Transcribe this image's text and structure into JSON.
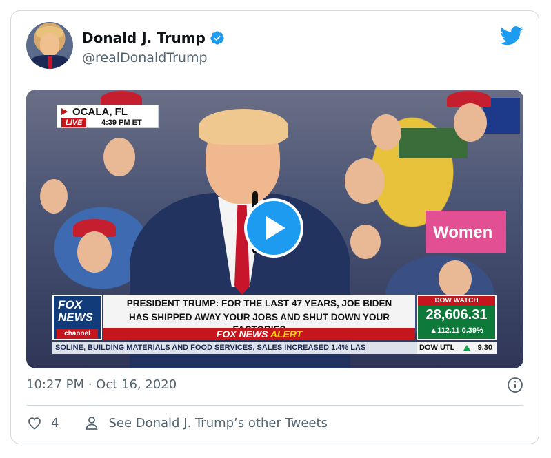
{
  "author": {
    "display_name": "Donald J. Trump",
    "handle": "@realDonaldTrump",
    "verified": true
  },
  "media": {
    "location": {
      "city": "OCALA, FL",
      "live": "LIVE",
      "time": "4:39 PM ET"
    },
    "sign_text": "Women",
    "fox_logo": [
      "FOX",
      "NEWS",
      "channel"
    ],
    "headline_line1": "PRESIDENT TRUMP: FOR THE LAST 47 YEARS, JOE BIDEN",
    "headline_line2": "HAS SHIPPED AWAY YOUR JOBS AND SHUT DOWN YOUR FACTORIES",
    "alert_prefix": "FOX NEWS",
    "alert_word": "ALERT",
    "dow": {
      "title": "DOW WATCH",
      "value": "28,606.31",
      "change": "▲112.11 0.39%"
    },
    "ticker": {
      "text": "SOLINE, BUILDING MATERIALS AND FOOD SERVICES, SALES INCREASED 1.4% LAS",
      "dow_label": "DOW UTL",
      "dow_value": "9.30"
    }
  },
  "timestamp": "10:27 PM · Oct 16, 2020",
  "actions": {
    "like_count": "4",
    "see_more": "See Donald J. Trump’s other Tweets"
  },
  "colors": {
    "twitter_blue": "#1d9bf0",
    "secondary_text": "#536471",
    "fox_red": "#c4161c",
    "fox_blue": "#123b7a",
    "dow_green": "#0e7a3a"
  },
  "icons": [
    "twitter-bird-icon",
    "verified-badge-icon",
    "play-icon",
    "info-icon",
    "heart-icon",
    "person-icon"
  ]
}
